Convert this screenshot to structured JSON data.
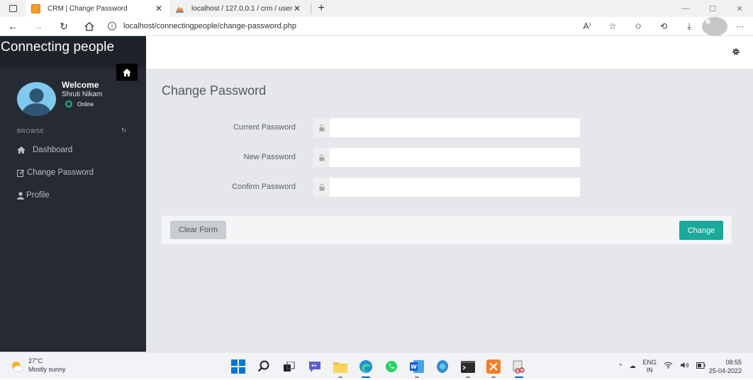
{
  "browser": {
    "tabs": [
      {
        "title": "CRM | Change Password",
        "active": true
      },
      {
        "title": "localhost / 127.0.0.1 / crm / user",
        "active": false
      }
    ],
    "url": "localhost/connectingpeople/change-password.php",
    "read_aloud_label": "A⁾"
  },
  "app": {
    "brand": "Connecting people",
    "user": {
      "welcome": "Welcome",
      "name": "Shruti Nikam",
      "status": "Online"
    },
    "browse_label": "BROWSE",
    "menu": [
      {
        "label": "Dashboard",
        "icon": "home-icon"
      },
      {
        "label": "Change Password",
        "icon": "edit-icon"
      },
      {
        "label": "Profile",
        "icon": "user-icon"
      }
    ]
  },
  "form": {
    "title": "Change Password",
    "fields": [
      {
        "label": "Current Password",
        "value": "",
        "placeholder": ""
      },
      {
        "label": "New Password",
        "value": "",
        "placeholder": ""
      },
      {
        "label": "Confirm Password",
        "value": "",
        "placeholder": ""
      }
    ],
    "clear_label": "Clear Form",
    "submit_label": "Change"
  },
  "taskbar": {
    "weather": {
      "temp": "27°C",
      "desc": "Mostly sunny"
    },
    "lang_top": "ENG",
    "lang_bottom": "IN",
    "time": "08:55",
    "date": "25-04-2022"
  },
  "colors": {
    "sidebar": "#1e2229",
    "sidebar_body": "#262a32",
    "content_bg": "#e5e7ea",
    "accent": "#1aa99b",
    "online": "#1ab394"
  }
}
